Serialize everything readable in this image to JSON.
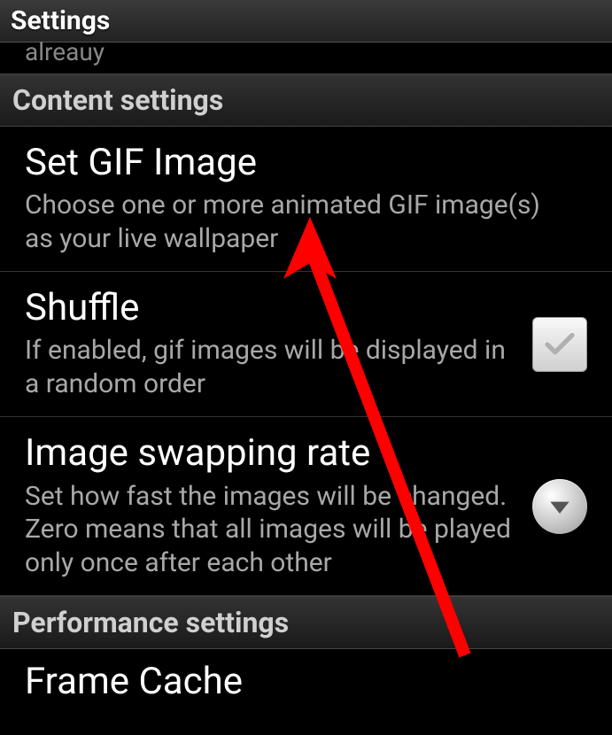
{
  "titleBar": {
    "title": "Settings"
  },
  "partialTop": "alreauy",
  "sections": {
    "content": {
      "header": "Content settings",
      "items": {
        "setGif": {
          "title": "Set GIF Image",
          "desc": "Choose one or more animated GIF image(s) as your live wallpaper"
        },
        "shuffle": {
          "title": "Shuffle",
          "desc": "If enabled, gif images will be displayed in a random order",
          "checked": false
        },
        "swapRate": {
          "title": "Image swapping rate",
          "desc": "Set how fast the images will be changed. Zero means that all images will be played only once after each other"
        }
      }
    },
    "performance": {
      "header": "Performance settings",
      "items": {
        "frameCache": {
          "title": "Frame Cache"
        }
      }
    }
  }
}
